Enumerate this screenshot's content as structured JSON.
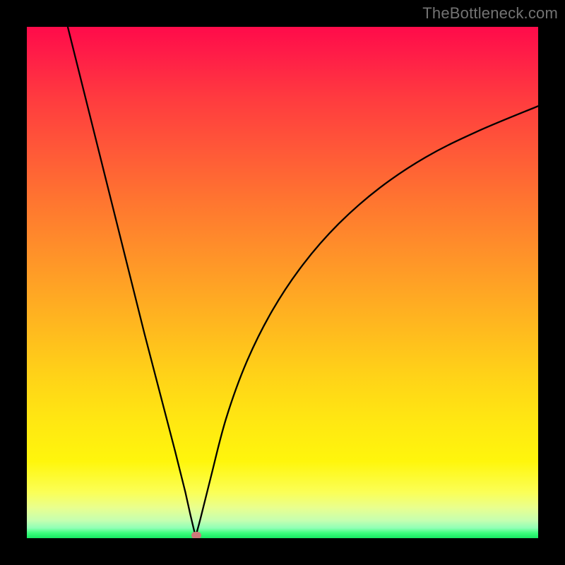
{
  "watermark": "TheBottleneck.com",
  "chart_data": {
    "type": "line",
    "title": "",
    "xlabel": "",
    "ylabel": "",
    "xlim": [
      0,
      100
    ],
    "ylim": [
      0,
      100
    ],
    "grid": false,
    "legend": false,
    "gradient_stops": [
      {
        "pos": 0,
        "color": "#ff0b4a"
      },
      {
        "pos": 0.5,
        "color": "#ffb420"
      },
      {
        "pos": 0.92,
        "color": "#fbff56"
      },
      {
        "pos": 1.0,
        "color": "#18e862"
      }
    ],
    "curve_description": "V-shaped bottleneck curve: steep near-linear left branch descending to a minimum near x≈33, asymmetric shallower right branch rising with decreasing slope toward the right edge.",
    "minimum_x": 33,
    "minimum_y": 0.3,
    "left_branch": [
      {
        "x": 8.0,
        "y": 100.0
      },
      {
        "x": 11.0,
        "y": 88.0
      },
      {
        "x": 14.0,
        "y": 76.0
      },
      {
        "x": 17.0,
        "y": 64.0
      },
      {
        "x": 20.0,
        "y": 52.0
      },
      {
        "x": 23.0,
        "y": 40.0
      },
      {
        "x": 26.0,
        "y": 28.5
      },
      {
        "x": 29.0,
        "y": 17.0
      },
      {
        "x": 31.0,
        "y": 9.0
      },
      {
        "x": 32.0,
        "y": 4.5
      },
      {
        "x": 33.0,
        "y": 0.3
      }
    ],
    "right_branch": [
      {
        "x": 33.0,
        "y": 0.3
      },
      {
        "x": 34.0,
        "y": 4.0
      },
      {
        "x": 36.0,
        "y": 12.0
      },
      {
        "x": 39.0,
        "y": 23.5
      },
      {
        "x": 43.0,
        "y": 34.5
      },
      {
        "x": 48.0,
        "y": 44.5
      },
      {
        "x": 54.0,
        "y": 53.5
      },
      {
        "x": 61.0,
        "y": 61.5
      },
      {
        "x": 69.0,
        "y": 68.5
      },
      {
        "x": 78.0,
        "y": 74.5
      },
      {
        "x": 88.0,
        "y": 79.5
      },
      {
        "x": 100.0,
        "y": 84.5
      }
    ],
    "marker": {
      "x": 33.2,
      "y": 0.6,
      "color": "#cc7a7a",
      "shape": "rounded-rect"
    }
  }
}
